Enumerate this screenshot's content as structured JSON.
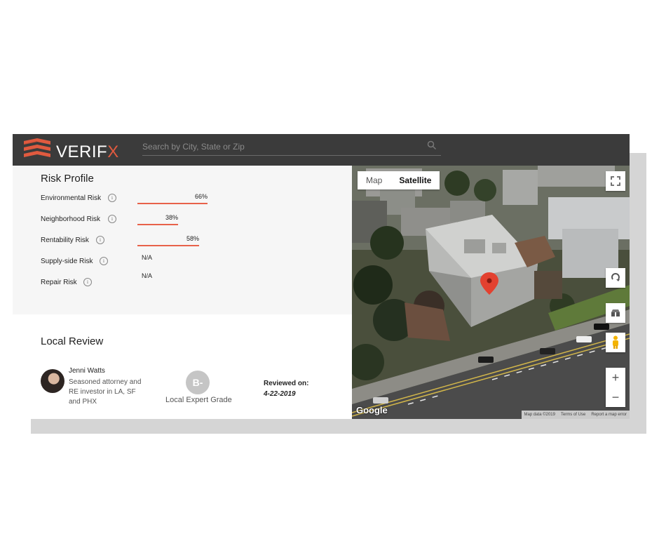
{
  "brand": {
    "name_main": "VERIF",
    "name_accent": "X",
    "accent_color": "#e05a3f"
  },
  "search": {
    "placeholder": "Search by City, State or Zip",
    "icon": "search-icon"
  },
  "risk_profile": {
    "title": "Risk Profile",
    "items": [
      {
        "label": "Environmental Risk",
        "value": "66%",
        "fraction": 0.66
      },
      {
        "label": "Neighborhood Risk",
        "value": "38%",
        "fraction": 0.38
      },
      {
        "label": "Rentability Risk",
        "value": "58%",
        "fraction": 0.58
      },
      {
        "label": "Supply-side Risk",
        "value": "N/A",
        "fraction": null
      },
      {
        "label": "Repair Risk",
        "value": "N/A",
        "fraction": null
      }
    ],
    "bar_color": "#e8624a"
  },
  "local_review": {
    "title": "Local Review",
    "reviewer_name": "Jenni Watts",
    "reviewer_desc": "Seasoned attorney and RE investor in LA, SF and PHX",
    "grade": "B-",
    "grade_label": "Local Expert Grade",
    "reviewed_on_label": "Reviewed on:",
    "reviewed_on_date": "4-22-2019"
  },
  "map": {
    "toggle_map": "Map",
    "toggle_satellite": "Satellite",
    "selected": "Satellite",
    "google_logo": "Google",
    "attribution": {
      "data": "Map data ©2019",
      "terms": "Terms of Use",
      "report": "Report a map error"
    },
    "controls": [
      "fullscreen-icon",
      "rotate-icon",
      "tilt-icon",
      "pegman-icon",
      "zoom-in-icon",
      "zoom-out-icon"
    ],
    "zoom_in_label": "+",
    "zoom_out_label": "−"
  }
}
